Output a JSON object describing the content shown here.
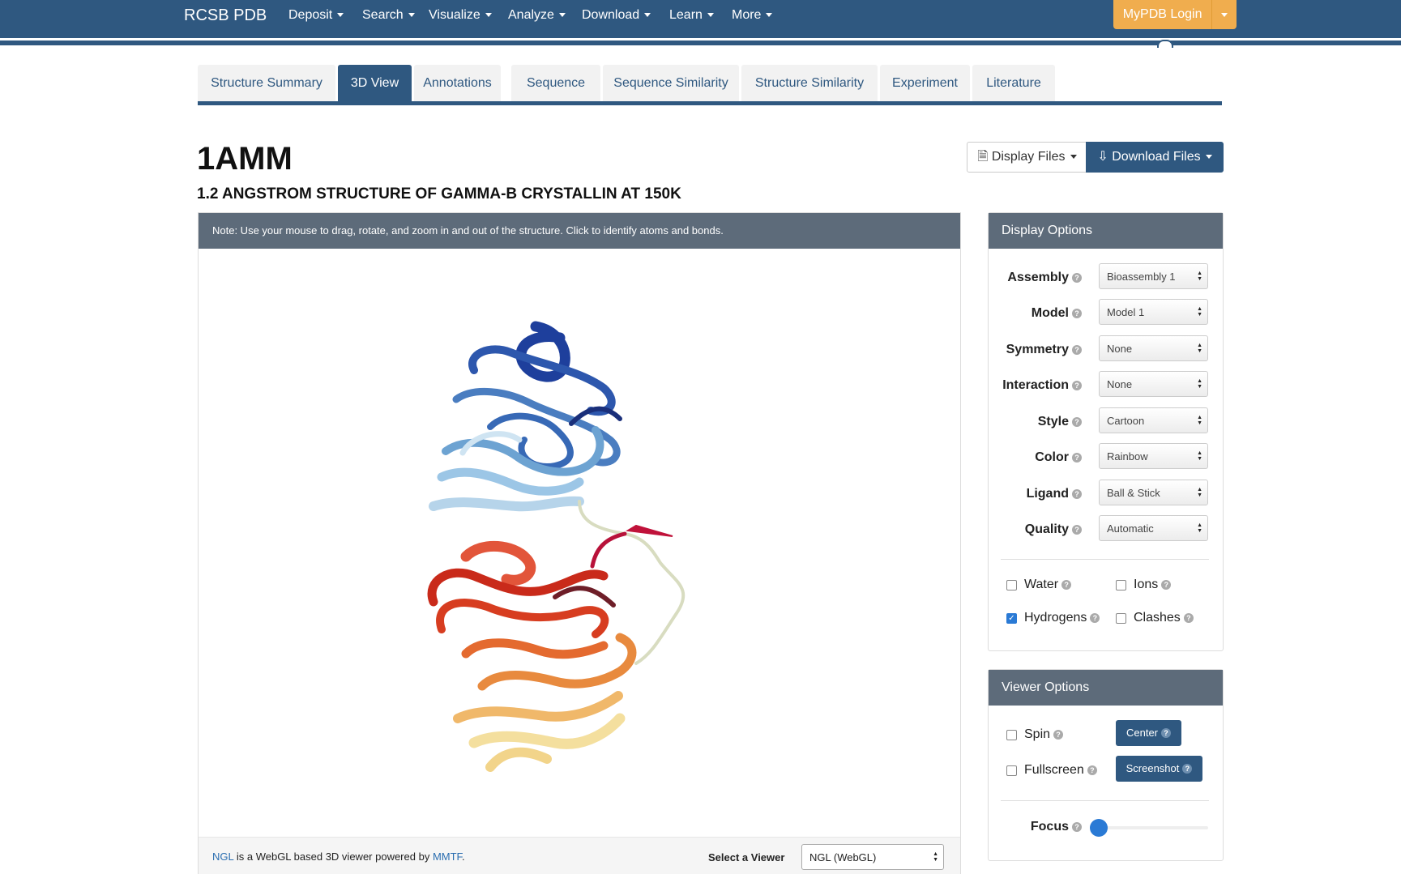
{
  "nav": {
    "brand": "RCSB PDB",
    "items": [
      "Deposit",
      "Search",
      "Visualize",
      "Analyze",
      "Download",
      "Learn",
      "More"
    ],
    "login": "MyPDB Login"
  },
  "tabs": [
    "Structure Summary",
    "3D View",
    "Annotations",
    "Sequence",
    "Sequence Similarity",
    "Structure Similarity",
    "Experiment",
    "Literature"
  ],
  "active_tab": "3D View",
  "entry": {
    "id": "1AMM",
    "title": "1.2 ANGSTROM STRUCTURE OF GAMMA-B CRYSTALLIN AT 150K",
    "display_files": "Display Files",
    "download_files": "Download Files"
  },
  "viewer": {
    "note": "Note: Use your mouse to drag, rotate, and zoom in and out of the structure. Click to identify atoms and bonds.",
    "footer_ngl": "NGL",
    "footer_mid": " is a WebGL based 3D viewer powered by ",
    "footer_mmtf": "MMTF",
    "footer_end": ".",
    "select_label": "Select a Viewer",
    "select_value": "NGL (WebGL)"
  },
  "display_options": {
    "heading": "Display Options",
    "rows": [
      {
        "label": "Assembly",
        "value": "Bioassembly 1"
      },
      {
        "label": "Model",
        "value": "Model 1"
      },
      {
        "label": "Symmetry",
        "value": "None"
      },
      {
        "label": "Interaction",
        "value": "None"
      },
      {
        "label": "Style",
        "value": "Cartoon"
      },
      {
        "label": "Color",
        "value": "Rainbow"
      },
      {
        "label": "Ligand",
        "value": "Ball & Stick"
      },
      {
        "label": "Quality",
        "value": "Automatic"
      }
    ],
    "checkboxes": {
      "water": {
        "label": "Water",
        "checked": false
      },
      "ions": {
        "label": "Ions",
        "checked": false
      },
      "hydrogens": {
        "label": "Hydrogens",
        "checked": true
      },
      "clashes": {
        "label": "Clashes",
        "checked": false
      }
    }
  },
  "viewer_options": {
    "heading": "Viewer Options",
    "spin": "Spin",
    "fullscreen": "Fullscreen",
    "center": "Center",
    "screenshot": "Screenshot",
    "focus": "Focus",
    "focus_value": 0
  }
}
